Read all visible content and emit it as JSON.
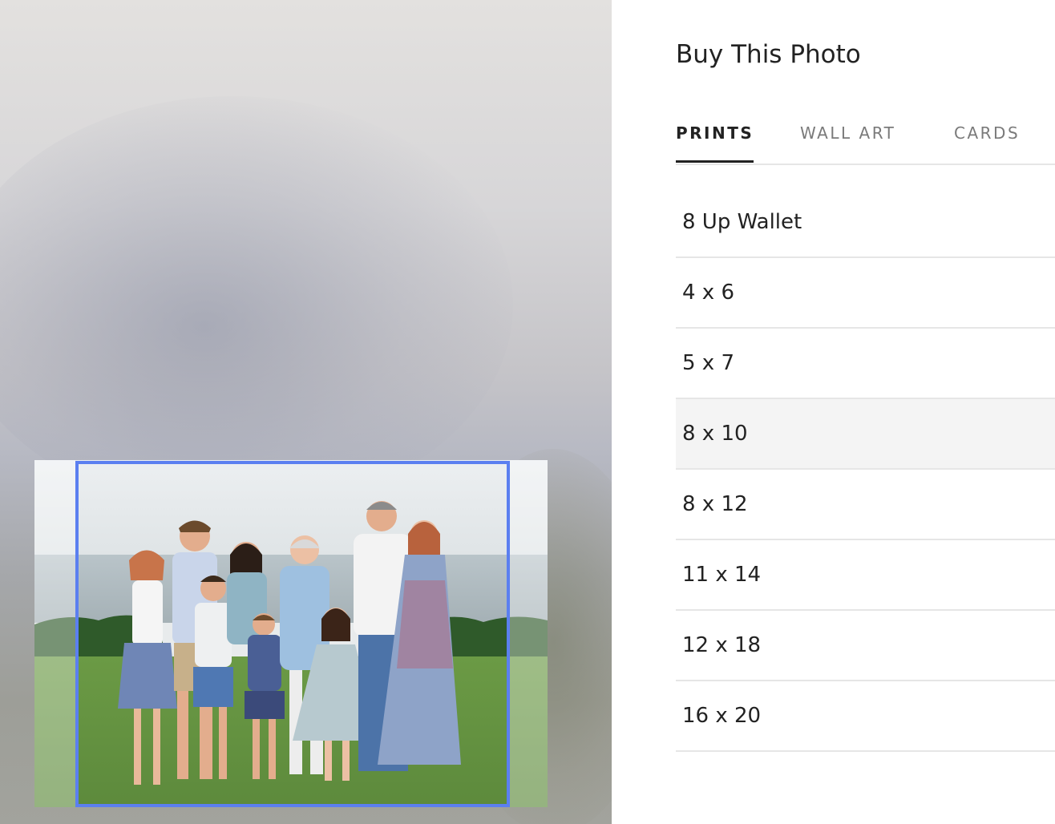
{
  "panel": {
    "title": "Buy This Photo"
  },
  "tabs": [
    {
      "label": "PRINTS",
      "active": true
    },
    {
      "label": "WALL ART",
      "active": false
    },
    {
      "label": "CARDS",
      "active": false
    }
  ],
  "sizes": [
    {
      "label": "8 Up Wallet"
    },
    {
      "label": "4 x 6"
    },
    {
      "label": "5 x 7"
    },
    {
      "label": "8 x 10",
      "highlighted": true
    },
    {
      "label": "8 x 12"
    },
    {
      "label": "11 x 14"
    },
    {
      "label": "12 x 18"
    },
    {
      "label": "16 x 20"
    }
  ],
  "colors": {
    "crop_border": "#5b7ff0",
    "active_tab": "#222222",
    "inactive_tab": "#7a7a7a",
    "hover_row": "#f4f4f4"
  },
  "photo": {
    "subject": "family-group-photo"
  }
}
